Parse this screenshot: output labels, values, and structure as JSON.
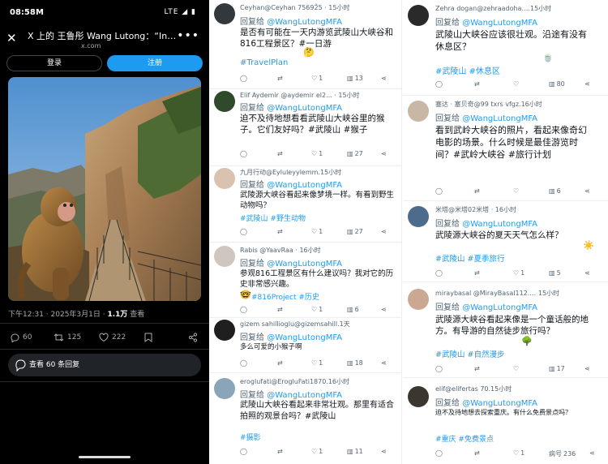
{
  "status": {
    "time": "08:58",
    "carrier_icon": "M",
    "signal": "LTE ◢ ▮"
  },
  "nav": {
    "title": "X 上的 王鲁彤 Wang Lutong：“Indon...",
    "domain": "x.com"
  },
  "auth": {
    "login": "登录",
    "register": "注册"
  },
  "post": {
    "time": "下午12:31 · 2025年3月1日 · ",
    "views_count": "1.1万",
    "views_label": " 查看",
    "replies": "60",
    "retweets": "125",
    "likes": "222",
    "view_replies": "查看 60 条回复"
  },
  "colors": {
    "accent": "#1d9bf0",
    "dark_bg": "#000000"
  },
  "tweets_mid": [
    {
      "handle": "Ceyhan@Ceyhan 75692̃5 · 15小时",
      "reply_prefix": "回复给 ",
      "reply_to": "@WangLutongMFA",
      "text": "是否有可能在一天内游览武陵山大峡谷和816工程景区？#一日游",
      "tags": "#TravelPlan",
      "emoji": "🤔",
      "reply_count": "",
      "retweet_count": "",
      "like_count": "1",
      "view_count": "13"
    },
    {
      "handle": "Elif Aydemir @aydemir el2... · 15小时",
      "reply_prefix": "回复给 ",
      "reply_to": "@WangLutongMFA",
      "text": "迫不及待地想看看武陵山大峡谷里的猴子。它们友好吗？#武陵山 #猴子",
      "tags": "",
      "emoji": "",
      "reply_count": "",
      "retweet_count": "",
      "like_count": "1",
      "view_count": "27"
    },
    {
      "handle": "九月行动@Eyluleyylemm.15小时",
      "reply_prefix": "回复给 ",
      "reply_to": "@WangLutongMFA",
      "text": "武陵源大峡谷看起来像梦境一样。有看到野生动物吗？",
      "tags": "#武陵山 #野生动物",
      "emoji": "",
      "reply_count": "",
      "retweet_count": "",
      "like_count": "1",
      "view_count": "27"
    },
    {
      "handle": "Rabis @YaavRaa · 16小时",
      "reply_prefix": "回复给 ",
      "reply_to": "@WangLutongMFA",
      "text": "参观816工程景区有什么建议吗？我对它的历史非常感兴趣。",
      "tags": "#816Project #历史",
      "emoji": "🤓",
      "reply_count": "",
      "retweet_count": "",
      "like_count": "1",
      "view_count": "6"
    },
    {
      "handle": "gizem sahillioglu@gizemsahill.1天",
      "reply_prefix": "回复给 ",
      "reply_to": "@WangLutongMFA",
      "text": "多么可爱的小猴子啊",
      "tags": "",
      "emoji": "",
      "reply_count": "",
      "retweet_count": "",
      "like_count": "1",
      "view_count": "18"
    },
    {
      "handle": "eroglufati@ErogluFati1870.16小时",
      "reply_prefix": "回复给 ",
      "reply_to": "@WangLutongMFA",
      "text": "武陵山大峡谷看起来非常壮观。那里有适合拍照的观景台吗？#武陵山",
      "tags": "#摄影",
      "emoji": "",
      "reply_count": "",
      "retweet_count": "",
      "like_count": "1",
      "view_count": "11"
    }
  ],
  "tweets_right": [
    {
      "handle": "Zehra dogan@zehraadoha.…15小时",
      "reply_prefix": "回复给 ",
      "reply_to": "@WangLutongMFA",
      "text": "武陵山大峡谷应该很壮观。沿途有没有休息区？",
      "tags": "#武陵山 #休息区",
      "emoji": "🍵",
      "reply_count": "",
      "retweet_count": "",
      "like_count": "",
      "view_count": "80"
    },
    {
      "handle": "塞达 · 塞贝奇@99 txrs vfgz.16小时",
      "reply_prefix": "回复给 ",
      "reply_to": "@WangLutongMFA",
      "text": "看到武岭大峡谷的照片，看起来像奇幻电影的场景。什么时候是最佳游览时间？#武岭大峡谷 #旅行计划",
      "tags": "",
      "emoji": "",
      "reply_count": "",
      "retweet_count": "",
      "like_count": "",
      "view_count": "6"
    },
    {
      "handle": "米塔@米塔02米塔 · 16小时",
      "reply_prefix": "回复给 ",
      "reply_to": "@WangLutongMFA",
      "text": "武陵源大峡谷的夏天天气怎么样？",
      "tags": "#武陵山 #夏季旅行",
      "emoji": "☀️",
      "reply_count": "",
      "retweet_count": "",
      "like_count": "1",
      "view_count": "5"
    },
    {
      "handle": "miraybasal @MirayBasal112.… 15小时",
      "reply_prefix": "回复给 ",
      "reply_to": "@WangLutongMFA",
      "text": "武陵源大峡谷看起来像是一个童话般的地方。有导游的自然徒步旅行吗？",
      "tags": "#武陵山 #自然漫步",
      "emoji": "🌳",
      "reply_count": "",
      "retweet_count": "",
      "like_count": "",
      "view_count": "17"
    },
    {
      "handle": "elif@elifertas 70.15小时",
      "reply_prefix": "回复给 ",
      "reply_to": "@WangLutongMFA",
      "text": "迫不及待地想去探索重庆。有什么免费景点吗？",
      "tags": "#重庆 #免费景点",
      "emoji": "",
      "reply_count": "",
      "retweet_count": "",
      "like_count": "1",
      "view_count": "236",
      "view_prefix": "病号 "
    }
  ]
}
